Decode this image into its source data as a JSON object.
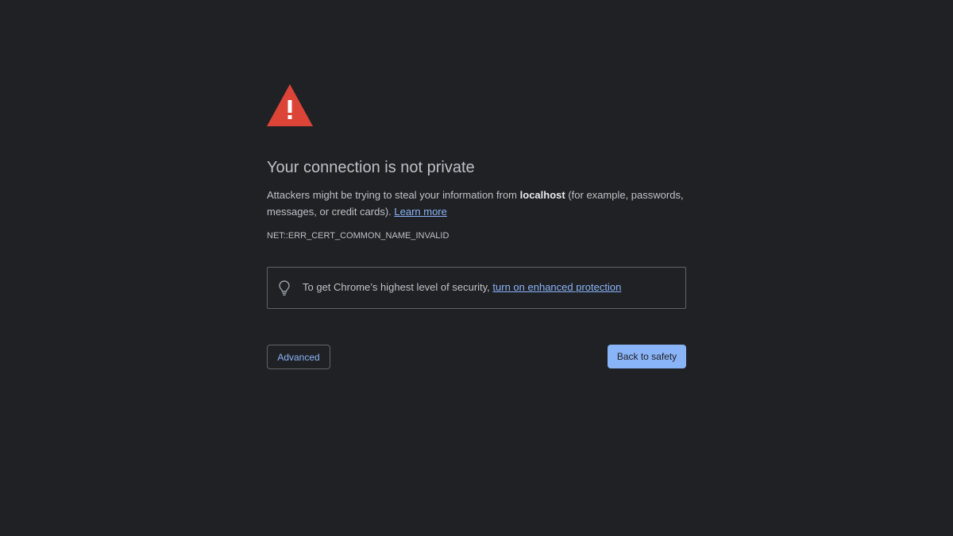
{
  "page": {
    "background": "#202124",
    "icon": "warning-triangle-icon",
    "icon_color": "#db4437"
  },
  "heading": "Your connection is not private",
  "explanation": {
    "before": "Attackers might be trying to steal your information from ",
    "host": "localhost",
    "after": " (for example, passwords, messages, or credit cards). ",
    "learn_more": "Learn more"
  },
  "error_code": "NET::ERR_CERT_COMMON_NAME_INVALID",
  "enhanced_protection": {
    "icon": "lightbulb-icon",
    "text": "To get Chrome’s highest level of security, ",
    "link": "turn on enhanced protection"
  },
  "buttons": {
    "advanced": "Advanced",
    "back_to_safety": "Back to safety"
  },
  "colors": {
    "link": "#8ab4f8",
    "primary_button": "#8ab4f8",
    "border": "#5f6368"
  }
}
